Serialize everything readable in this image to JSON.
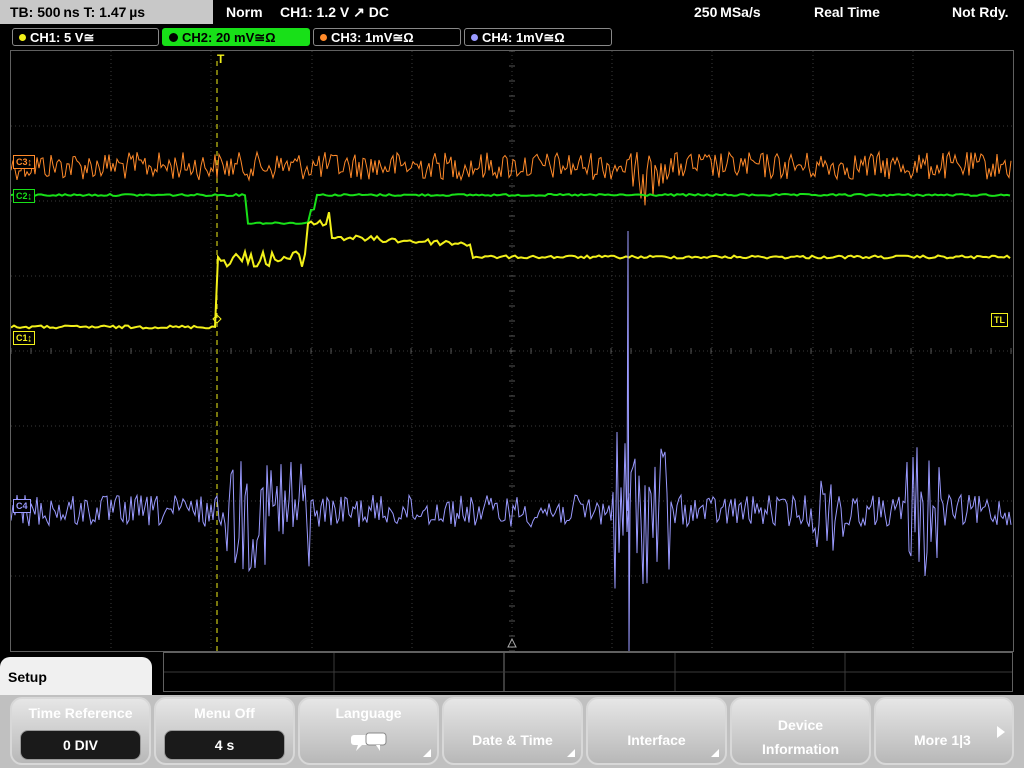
{
  "top_bar": {
    "timebase": "TB: 500 ns   T: 1.47 µs",
    "mode": "Norm",
    "trigger": "CH1: 1.2 V ↗ DC",
    "sample_rate": "250 MSa/s",
    "acq_mode": "Real Time",
    "status": "Not Rdy."
  },
  "channels": [
    {
      "label": "CH1: 5 V≅",
      "color": "#f2f01a",
      "active": false
    },
    {
      "label": "CH2: 20 mV≅Ω",
      "color": "#18e018",
      "active": true
    },
    {
      "label": "CH3: 1mV≅Ω",
      "color": "#ff8a2a",
      "active": false
    },
    {
      "label": "CH4: 1mV≅Ω",
      "color": "#9a9aff",
      "active": false
    }
  ],
  "markers": {
    "c3": "C3↨",
    "c2": "C2↨",
    "c1": "C1↨",
    "c4": "C4",
    "tl": "TL",
    "trigger": "T"
  },
  "setup_tab": "Setup",
  "softkeys": [
    {
      "label": "Time Reference",
      "value": "0 DIV"
    },
    {
      "label": "Menu Off",
      "value": "4 s"
    },
    {
      "label": "Language",
      "icon": "speech-bubbles-icon"
    },
    {
      "label": "Date & Time"
    },
    {
      "label": "Interface"
    },
    {
      "label": "Device Information"
    },
    {
      "label": "More 1|3"
    }
  ]
}
